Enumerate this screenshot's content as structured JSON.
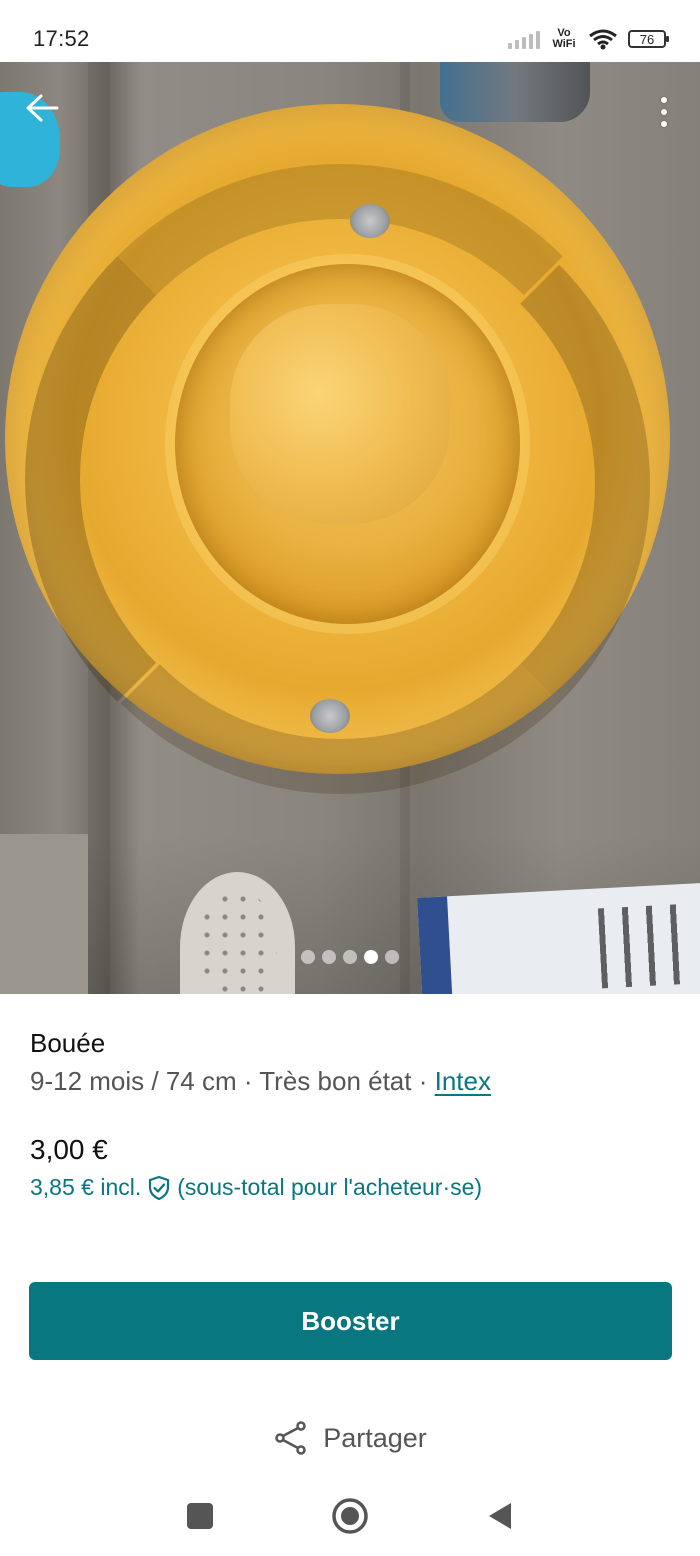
{
  "status_bar": {
    "time": "17:52",
    "network": "Vo WiFi",
    "battery": "76"
  },
  "photo": {
    "gallery_count": 5,
    "active_index": 3
  },
  "listing": {
    "title": "Bouée",
    "details": "9-12 mois / 74 cm · Très bon état · ",
    "brand": "Intex",
    "price": "3,00 €",
    "price_incl": "3,85 € incl.",
    "price_incl_note": "(sous-total pour l'acheteur·se)"
  },
  "actions": {
    "boost_label": "Booster",
    "share_label": "Partager"
  },
  "colors": {
    "accent": "#087780"
  },
  "icons": {
    "back": "arrow-left-icon",
    "more": "more-vertical-icon",
    "shield": "shield-check-icon",
    "share": "share-icon",
    "nav_recents": "square-icon",
    "nav_home": "circle-icon",
    "nav_back": "triangle-back-icon"
  }
}
